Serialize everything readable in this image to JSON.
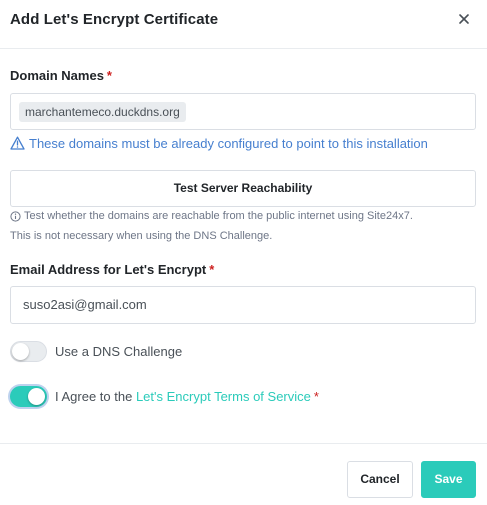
{
  "dialog": {
    "title": "Add Let's Encrypt Certificate",
    "close_icon": "close-icon"
  },
  "domains": {
    "label": "Domain Names",
    "required_mark": "*",
    "values": [
      "marchantemeco.duckdns.org"
    ],
    "warning_icon": "warning-triangle-icon",
    "warning": "These domains must be already configured to point to this installation"
  },
  "test_button": {
    "label": "Test Server Reachability",
    "hint_icon": "info-circle-icon",
    "hint_line1": "Test whether the domains are reachable from the public internet using Site24x7.",
    "hint_line2": "This is not necessary when using the DNS Challenge."
  },
  "email": {
    "label": "Email Address for Let's Encrypt",
    "required_mark": "*",
    "value": "suso2asi@gmail.com"
  },
  "dns_challenge": {
    "label": "Use a DNS Challenge",
    "checked": false
  },
  "agree": {
    "prefix": "I Agree to the ",
    "link": "Let's Encrypt Terms of Service",
    "required_mark": "*",
    "checked": true
  },
  "footer": {
    "cancel_label": "Cancel",
    "save_label": "Save"
  },
  "colors": {
    "accent": "#2bcbba",
    "warning_text": "#467fcf",
    "required": "#cd201f"
  }
}
